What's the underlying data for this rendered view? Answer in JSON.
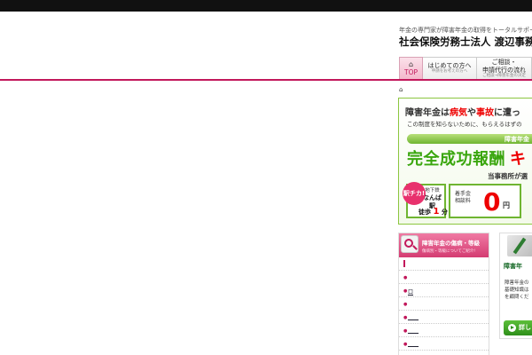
{
  "header": {
    "tagline": "年金の専門家が障害年金の取得をトータルサポート",
    "firm_name": "社会保険労務士法人 渡辺事務"
  },
  "nav": {
    "home_label": "TOP",
    "items": [
      {
        "label": "はじめての方へ",
        "sub": "申請をお考えの方へ"
      },
      {
        "label_line1": "ご相談・",
        "label_line2": "申請代行の流れ",
        "sub": "ご相談→障害年金の決定"
      }
    ]
  },
  "banner": {
    "headline_1": "障害年金は",
    "headline_2": "病気",
    "headline_3": "や",
    "headline_4": "事故",
    "headline_5": "に遭っ",
    "subline": "この制度を知らないために、もらえるはずの",
    "green_bar": "障害年金",
    "big_text": "完全成功報酬",
    "big_text_red": "キ",
    "note": "当事務所が選",
    "badge": "駅チカ!",
    "station_line1": "地下鉄",
    "station_line2": "なんば駅",
    "walk_prefix": "徒歩",
    "walk_num": "1",
    "walk_suffix": "分",
    "fee_label_1": "着手金",
    "fee_label_2": "相談料",
    "fee_value": "0",
    "fee_unit": "円"
  },
  "categories": {
    "title": "障害年金の傷病・等級",
    "subtitle": "傷病別・等級についてご紹介!",
    "rows": [
      "",
      "",
      "口",
      "",
      "____",
      "____",
      "____"
    ]
  },
  "consult": {
    "title": "障害年",
    "text_1": "障害年金の",
    "text_2": "基礎知識は",
    "text_3": "を顧問くだ",
    "button": "詳し"
  },
  "colors": {
    "accent_pink": "#c2185b",
    "accent_green": "#6fb531",
    "red": "#e00000",
    "topbar": "#111111"
  }
}
